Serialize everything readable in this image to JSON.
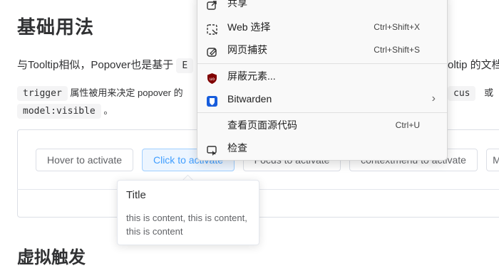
{
  "doc": {
    "heading": "基础用法",
    "para1_text": "与Tooltip相似，Popover也是基于",
    "para1_code": "E",
    "para1_right": "oltip 的文档",
    "trigger_code": "trigger",
    "para2_text": "属性被用来决定 popover 的",
    "para2_right_code": "cus",
    "para2_or": "或",
    "para2_right_code2": "c",
    "model_code": "model:visible",
    "para2_end": "。",
    "next_heading": "虚拟触发"
  },
  "demo": {
    "buttons": [
      {
        "label": "Hover to activate"
      },
      {
        "label": "Click to activate"
      },
      {
        "label": "Focus to activate"
      },
      {
        "label": "contextmenu to activate"
      },
      {
        "label": "M"
      }
    ]
  },
  "popover": {
    "title": "Title",
    "content": "this is content, this is content, this is content"
  },
  "context_menu": {
    "items": [
      {
        "label": "共享",
        "icon": "share-icon"
      },
      {
        "label": "Web 选择",
        "shortcut": "Ctrl+Shift+X",
        "icon": "web-select-icon"
      },
      {
        "label": "网页捕获",
        "shortcut": "Ctrl+Shift+S",
        "icon": "web-capture-icon"
      },
      {
        "label": "屏蔽元素...",
        "icon": "ublock-icon"
      },
      {
        "label": "Bitwarden",
        "icon": "bitwarden-icon"
      },
      {
        "label": "查看页面源代码",
        "shortcut": "Ctrl+U"
      },
      {
        "label": "检查",
        "icon": "inspect-icon"
      }
    ]
  }
}
